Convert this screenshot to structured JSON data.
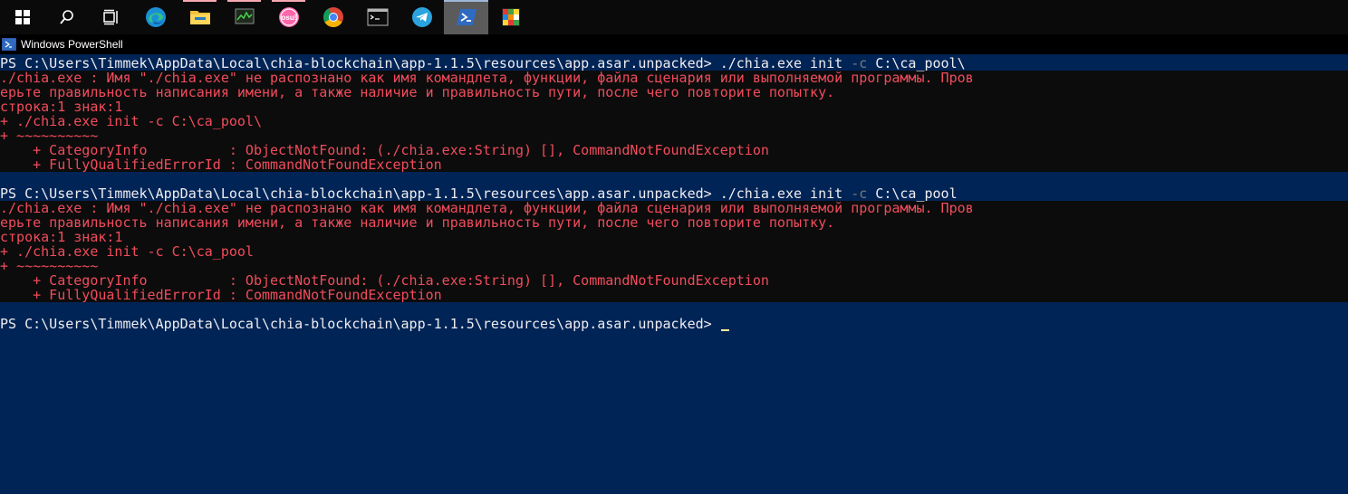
{
  "taskbar": {
    "items": [
      {
        "name": "start-button",
        "icon": "windows-logo-icon"
      },
      {
        "name": "search-button",
        "icon": "search-icon"
      },
      {
        "name": "task-view-button",
        "icon": "task-view-icon"
      },
      {
        "name": "edge-app",
        "icon": "edge-icon"
      },
      {
        "name": "file-explorer-app",
        "icon": "folder-icon"
      },
      {
        "name": "monitor-app",
        "icon": "monitor-icon"
      },
      {
        "name": "osu-app",
        "icon": "osu-icon",
        "label": "osu!"
      },
      {
        "name": "chrome-app",
        "icon": "chrome-icon"
      },
      {
        "name": "terminal-app",
        "icon": "terminal-icon"
      },
      {
        "name": "telegram-app",
        "icon": "telegram-icon"
      },
      {
        "name": "powershell-app",
        "icon": "powershell-icon"
      },
      {
        "name": "rubiks-app",
        "icon": "rubiks-cube-icon"
      }
    ]
  },
  "window": {
    "title": "Windows PowerShell"
  },
  "console": {
    "block1": {
      "prompt": "PS C:\\Users\\Timmek\\AppData\\Local\\chia-blockchain\\app-1.1.5\\resources\\app.asar.unpacked> ",
      "cmd_a": "./chia.exe init ",
      "cmd_flag": "-c",
      "cmd_b": " C:\\ca_pool\\",
      "err1": "./chia.exe : Имя \"./chia.exe\" не распознано как имя командлета, функции, файла сценария или выполняемой программы. Пров",
      "err2": "ерьте правильность написания имени, а также наличие и правильность пути, после чего повторите попытку.",
      "err3": "строка:1 знак:1",
      "err4": "+ ./chia.exe init -c C:\\ca_pool\\",
      "err5": "+ ~~~~~~~~~~",
      "err6": "    + CategoryInfo          : ObjectNotFound: (./chia.exe:String) [], CommandNotFoundException",
      "err7": "    + FullyQualifiedErrorId : CommandNotFoundException"
    },
    "block2": {
      "prompt": "PS C:\\Users\\Timmek\\AppData\\Local\\chia-blockchain\\app-1.1.5\\resources\\app.asar.unpacked> ",
      "cmd_a": "./chia.exe init ",
      "cmd_flag": "-c",
      "cmd_b": " C:\\ca_pool",
      "err1": "./chia.exe : Имя \"./chia.exe\" не распознано как имя командлета, функции, файла сценария или выполняемой программы. Пров",
      "err2": "ерьте правильность написания имени, а также наличие и правильность пути, после чего повторите попытку.",
      "err3": "строка:1 знак:1",
      "err4": "+ ./chia.exe init -c C:\\ca_pool",
      "err5": "+ ~~~~~~~~~~",
      "err6": "    + CategoryInfo          : ObjectNotFound: (./chia.exe:String) [], CommandNotFoundException",
      "err7": "    + FullyQualifiedErrorId : CommandNotFoundException"
    },
    "current_prompt": "PS C:\\Users\\Timmek\\AppData\\Local\\chia-blockchain\\app-1.1.5\\resources\\app.asar.unpacked> "
  },
  "colors": {
    "console_bg": "#012456",
    "error_bg": "#0c0c0c",
    "error_fg": "#f14c5c",
    "text_fg": "#eeedf0",
    "flag_fg": "#7a7a7a"
  }
}
